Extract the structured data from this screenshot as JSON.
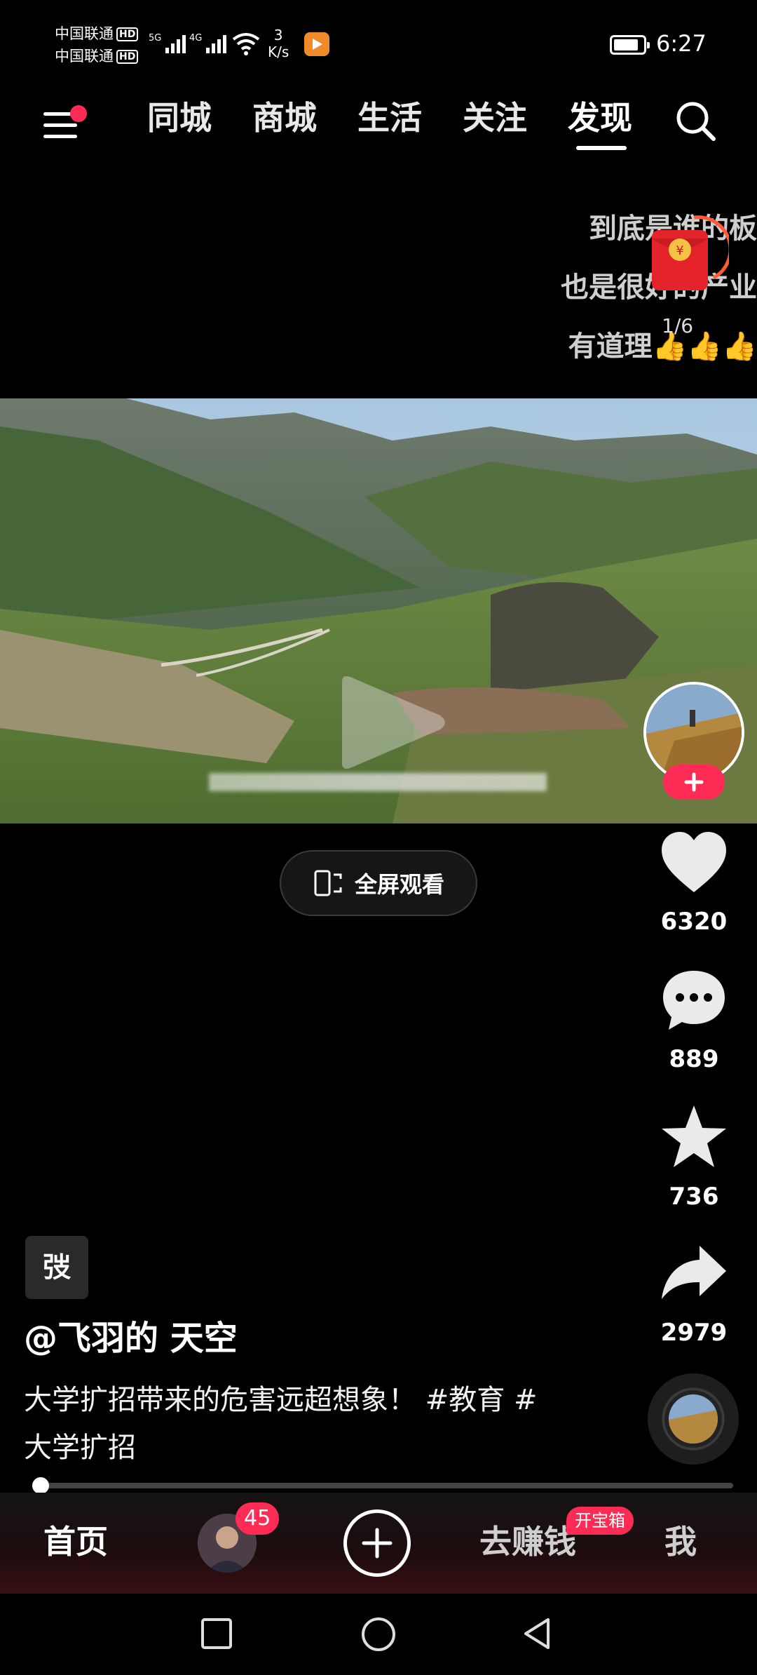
{
  "status_bar": {
    "carrier_1": "中国联通",
    "carrier_2": "中国联通",
    "hd": "HD",
    "sig1_tag": "5G",
    "sig2_tag": "4G",
    "net_speed_value": "3",
    "net_speed_unit": "K/s",
    "time": "6:27",
    "battery_level": 0.85
  },
  "top_nav": {
    "tabs": [
      {
        "label": "同城"
      },
      {
        "label": "商城"
      },
      {
        "label": "生活"
      },
      {
        "label": "关注"
      },
      {
        "label": "发现"
      }
    ],
    "active_tab": "发现"
  },
  "overlay": {
    "lines": [
      "到底是谁的板",
      "也是很好的产业",
      "有道理👍👍👍"
    ],
    "page_counter": "1/6"
  },
  "video": {
    "fullscreen_label": "全屏观看"
  },
  "side_rail": {
    "likes": "6320",
    "comments": "889",
    "favorites": "736",
    "shares": "2979"
  },
  "caption": {
    "badge": "弢",
    "author": "@飞羽的 天空",
    "description": "大学扩招带来的危害远超想象！ #教育 #大学扩招"
  },
  "progress": {
    "fraction": 0.01
  },
  "bottom_bar": {
    "home": "首页",
    "friends_badge": "45",
    "earn": "去赚钱",
    "earn_badge": "开宝箱",
    "me": "我"
  },
  "colors": {
    "accent": "#fe2c55",
    "background": "#000000"
  }
}
